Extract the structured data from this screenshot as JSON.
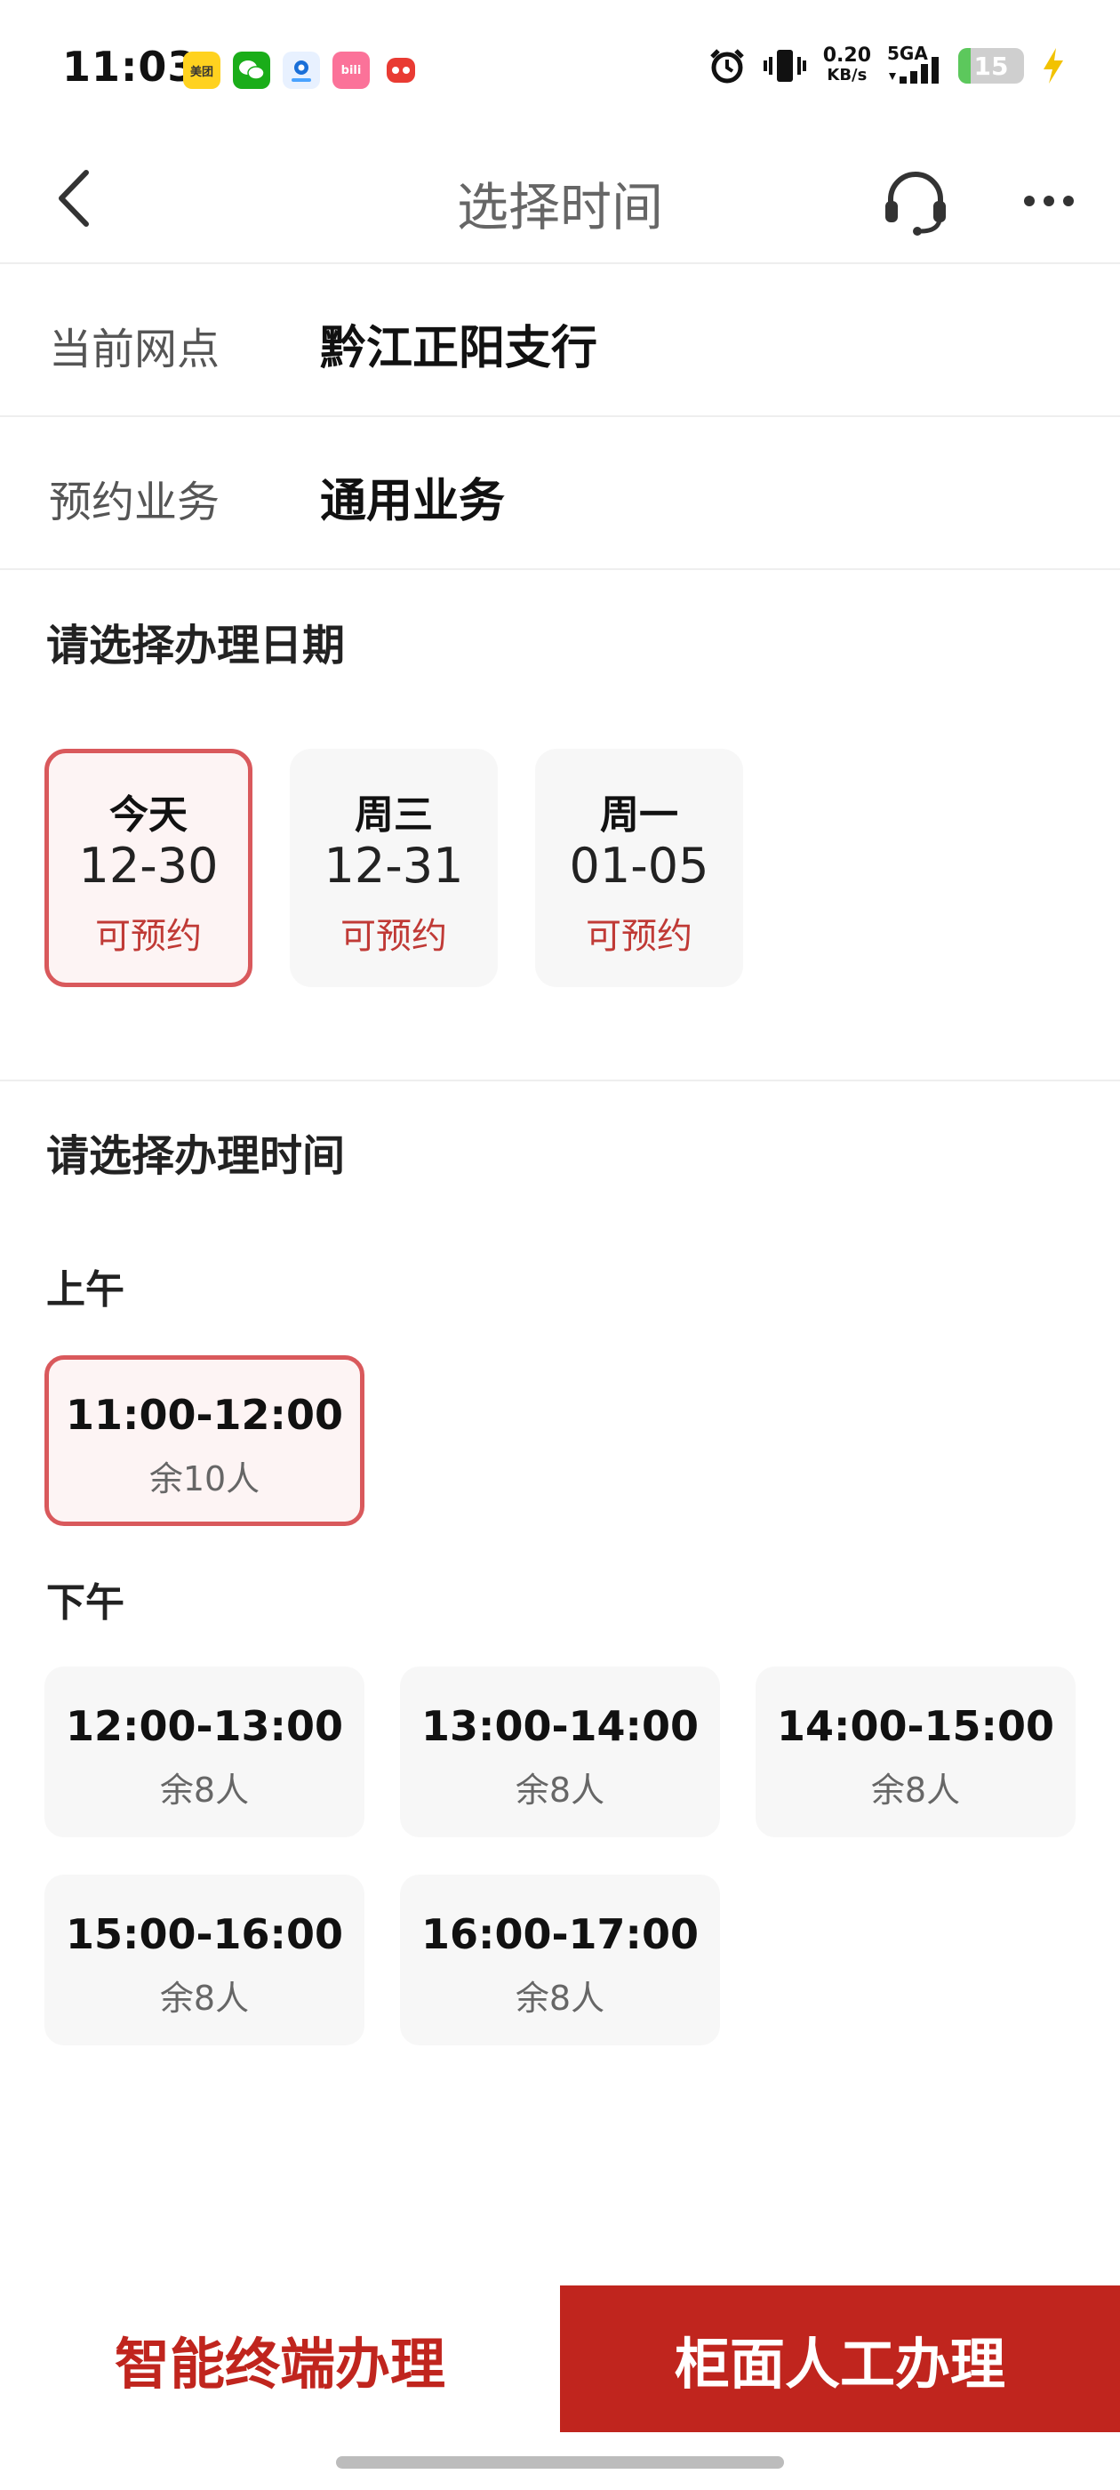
{
  "status_bar": {
    "time": "11:03",
    "net_speed_value": "0.20",
    "net_speed_unit": "KB/s",
    "network": "5GA",
    "battery": "15",
    "app_icons": [
      {
        "name": "meituan-app-icon",
        "label": "美团",
        "color": "#ffd21f",
        "text_color": "#333333"
      },
      {
        "name": "wechat-app-icon",
        "label": "",
        "color": "#1aad19",
        "text_color": "#ffffff"
      },
      {
        "name": "blue-app-icon",
        "label": "",
        "color": "#e8f1ff",
        "text_color": "#1a6fd8"
      },
      {
        "name": "bilibili-app-icon",
        "label": "bili",
        "color": "#fb7299",
        "text_color": "#ffffff"
      },
      {
        "name": "red-app-icon",
        "label": "",
        "color": "#e93b33",
        "text_color": "#ffffff"
      }
    ]
  },
  "nav": {
    "title": "选择时间"
  },
  "info": {
    "branch_label": "当前网点",
    "branch_value": "黔江正阳支行",
    "business_label": "预约业务",
    "business_value": "通用业务"
  },
  "date_section": {
    "title": "请选择办理日期",
    "dates": [
      {
        "day": "今天",
        "date": "12-30",
        "status": "可预约",
        "selected": true
      },
      {
        "day": "周三",
        "date": "12-31",
        "status": "可预约",
        "selected": false
      },
      {
        "day": "周一",
        "date": "01-05",
        "status": "可预约",
        "selected": false
      }
    ]
  },
  "time_section": {
    "title": "请选择办理时间",
    "morning_label": "上午",
    "morning_slots": [
      {
        "time": "11:00-12:00",
        "remain": "余10人",
        "selected": true
      }
    ],
    "afternoon_label": "下午",
    "afternoon_slots": [
      {
        "time": "12:00-13:00",
        "remain": "余8人"
      },
      {
        "time": "13:00-14:00",
        "remain": "余8人"
      },
      {
        "time": "14:00-15:00",
        "remain": "余8人"
      },
      {
        "time": "15:00-16:00",
        "remain": "余8人"
      },
      {
        "time": "16:00-17:00",
        "remain": "余8人"
      }
    ]
  },
  "actions": {
    "smart_terminal": "智能终端办理",
    "counter_manual": "柜面人工办理"
  },
  "colors": {
    "accent_red": "#c0251e",
    "selected_border": "#d9595c",
    "status_red": "#c03a36"
  }
}
